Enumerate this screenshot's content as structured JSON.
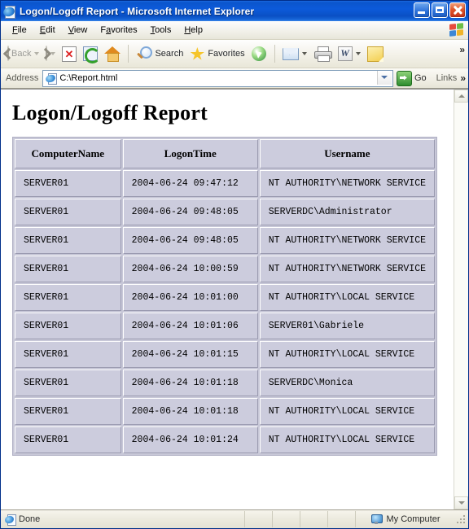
{
  "window": {
    "title": "Logon/Logoff Report - Microsoft Internet Explorer",
    "app_icon": "ie-document-icon",
    "caption": {
      "minimize": "Minimize",
      "maximize": "Maximize",
      "close": "Close"
    }
  },
  "menubar": {
    "items": [
      {
        "label": "File",
        "accel": "F"
      },
      {
        "label": "Edit",
        "accel": "E"
      },
      {
        "label": "View",
        "accel": "V"
      },
      {
        "label": "Favorites",
        "accel": "a"
      },
      {
        "label": "Tools",
        "accel": "T"
      },
      {
        "label": "Help",
        "accel": "H"
      }
    ]
  },
  "toolbar": {
    "back_label": "Back",
    "back_enabled": false,
    "forward_label": "",
    "stop_label": "",
    "refresh_label": "",
    "home_label": "",
    "search_label": "Search",
    "favorites_label": "Favorites",
    "media_label": "",
    "mail_label": "",
    "print_label": "",
    "edit_word_label": "",
    "notes_label": "",
    "overflow_label": "»",
    "icons": [
      "back-icon",
      "forward-icon",
      "stop-icon",
      "refresh-icon",
      "home-icon",
      "search-icon",
      "favorites-star-icon",
      "media-icon",
      "mail-icon",
      "print-icon",
      "edit-word-icon",
      "notes-icon"
    ]
  },
  "address_bar": {
    "label": "Address",
    "value": "C:\\Report.html",
    "placeholder": "",
    "favicon": "ie-document-icon",
    "dropdown_icon": "chevron-down-icon",
    "go_label": "Go",
    "links_label": "Links",
    "overflow_label": "»"
  },
  "page": {
    "title": "Logon/Logoff Report",
    "table": {
      "columns": [
        "ComputerName",
        "LogonTime",
        "Username"
      ],
      "rows": [
        [
          "SERVER01",
          "2004-06-24 09:47:12",
          "NT AUTHORITY\\NETWORK SERVICE"
        ],
        [
          "SERVER01",
          "2004-06-24 09:48:05",
          "SERVERDC\\Administrator"
        ],
        [
          "SERVER01",
          "2004-06-24 09:48:05",
          "NT AUTHORITY\\NETWORK SERVICE"
        ],
        [
          "SERVER01",
          "2004-06-24 10:00:59",
          "NT AUTHORITY\\NETWORK SERVICE"
        ],
        [
          "SERVER01",
          "2004-06-24 10:01:00",
          "NT AUTHORITY\\LOCAL SERVICE"
        ],
        [
          "SERVER01",
          "2004-06-24 10:01:06",
          "SERVER01\\Gabriele"
        ],
        [
          "SERVER01",
          "2004-06-24 10:01:15",
          "NT AUTHORITY\\LOCAL SERVICE"
        ],
        [
          "SERVER01",
          "2004-06-24 10:01:18",
          "SERVERDC\\Monica"
        ],
        [
          "SERVER01",
          "2004-06-24 10:01:18",
          "NT AUTHORITY\\LOCAL SERVICE"
        ],
        [
          "SERVER01",
          "2004-06-24 10:01:24",
          "NT AUTHORITY\\LOCAL SERVICE"
        ]
      ]
    }
  },
  "scrollbar": {
    "up_icon": "scroll-up-arrow-icon",
    "down_icon": "scroll-down-arrow-icon"
  },
  "statusbar": {
    "status_text": "Done",
    "status_icon": "ie-document-icon",
    "zone_text": "My Computer",
    "zone_icon": "my-computer-icon"
  },
  "colors": {
    "titlebar_blue": "#0b55cc",
    "table_cell": "#ccccdd",
    "page_background": "#ffffff",
    "chrome": "#ece9d8"
  }
}
